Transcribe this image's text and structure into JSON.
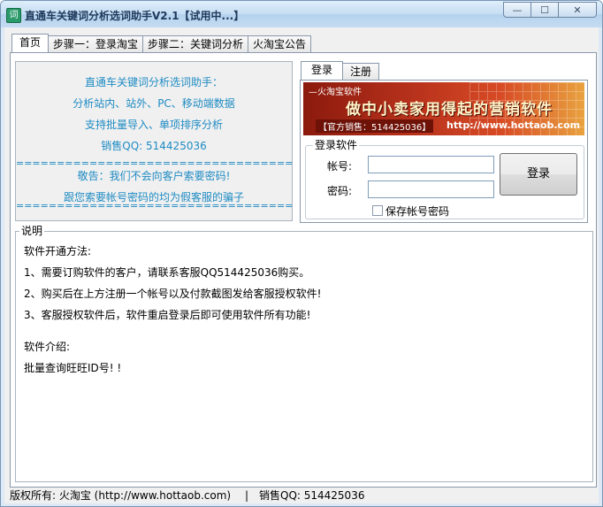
{
  "window": {
    "title": "直通车关键词分析选词助手V2.1【试用中...】",
    "buttons": {
      "minimize": "—",
      "maximize": "☐",
      "close": "✕"
    }
  },
  "tabs": [
    {
      "label": "首页",
      "active": true
    },
    {
      "label": "步骤一：登录淘宝",
      "active": false
    },
    {
      "label": "步骤二：关键词分析",
      "active": false
    },
    {
      "label": "火淘宝公告",
      "active": false
    }
  ],
  "info": {
    "title": "直通车关键词分析选词助手：",
    "line1": "分析站内、站外、PC、移动端数据",
    "line2": "支持批量导入、单项排序分析",
    "sales_qq": "销售QQ: 514425036",
    "sep1": "==================================",
    "warn1": "敬告：我们不会向客户索要密码!",
    "warn2": "跟您索要帐号密码的均为假客服的骗子",
    "sep2": "=================================="
  },
  "login": {
    "tabs": [
      {
        "label": "登录",
        "active": true
      },
      {
        "label": "注册",
        "active": false
      }
    ],
    "banner": {
      "top": "—火淘宝软件",
      "slogan": "做中小卖家用得起的营销软件",
      "official": "【官方销售：514425036】",
      "url": "http://www.hottaob.com"
    },
    "group_title": "登录软件",
    "account_label": "帐号:",
    "password_label": "密码:",
    "account_value": "",
    "password_value": "",
    "login_button": "登录",
    "save_checkbox_label": "保存帐号密码",
    "save_checked": false
  },
  "description": {
    "legend": "说明",
    "lines": [
      "软件开通方法:",
      "1、需要订购软件的客户，请联系客服QQ514425036购买。",
      "2、购买后在上方注册一个帐号以及付款截图发给客服授权软件!",
      "3、客服授权软件后，软件重启登录后即可使用软件所有功能!",
      "",
      "软件介绍:",
      "批量查询旺旺ID号! !"
    ]
  },
  "status": {
    "copyright": "版权所有: 火淘宝 (http://www.hottaob.com)",
    "separator": "|",
    "sales_qq": "销售QQ: 514425036"
  }
}
